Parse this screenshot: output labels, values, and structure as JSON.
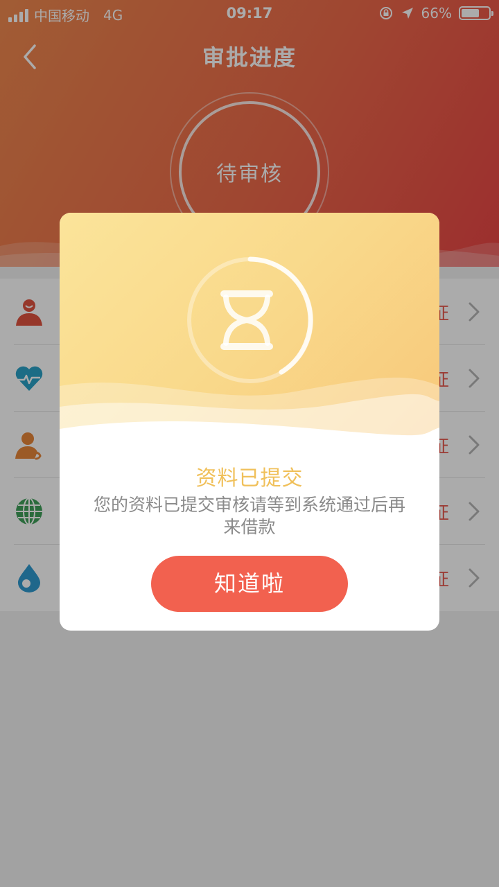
{
  "status_bar": {
    "carrier": "中国移动",
    "network": "4G",
    "time": "09:17",
    "battery_percent": "66%",
    "battery_level": 0.66
  },
  "nav": {
    "title": "审批进度",
    "back_icon": "chevron-left-icon"
  },
  "progress_ring": {
    "label": "待审核"
  },
  "list": {
    "items": [
      {
        "icon": "person-icon",
        "icon_color": "#e0533f",
        "status": "证"
      },
      {
        "icon": "heart-pulse-icon",
        "icon_color": "#2aa1c7",
        "status": "证"
      },
      {
        "icon": "contact-phone-icon",
        "icon_color": "#e8863a",
        "status": "证"
      },
      {
        "icon": "globe-icon",
        "icon_color": "#3fa05a",
        "status": "证"
      },
      {
        "icon": "drop-icon",
        "icon_color": "#2f9ad0",
        "status": "证"
      }
    ]
  },
  "dialog": {
    "icon": "hourglass-icon",
    "title": "资料已提交",
    "message": "您的资料已提交审核请等到系统通过后再来借款",
    "button_label": "知道啦"
  },
  "colors": {
    "header_gradient_start": "#f08a4f",
    "header_gradient_end": "#e94545",
    "accent_button": "#f2614f",
    "dialog_title": "#f0c05a"
  }
}
